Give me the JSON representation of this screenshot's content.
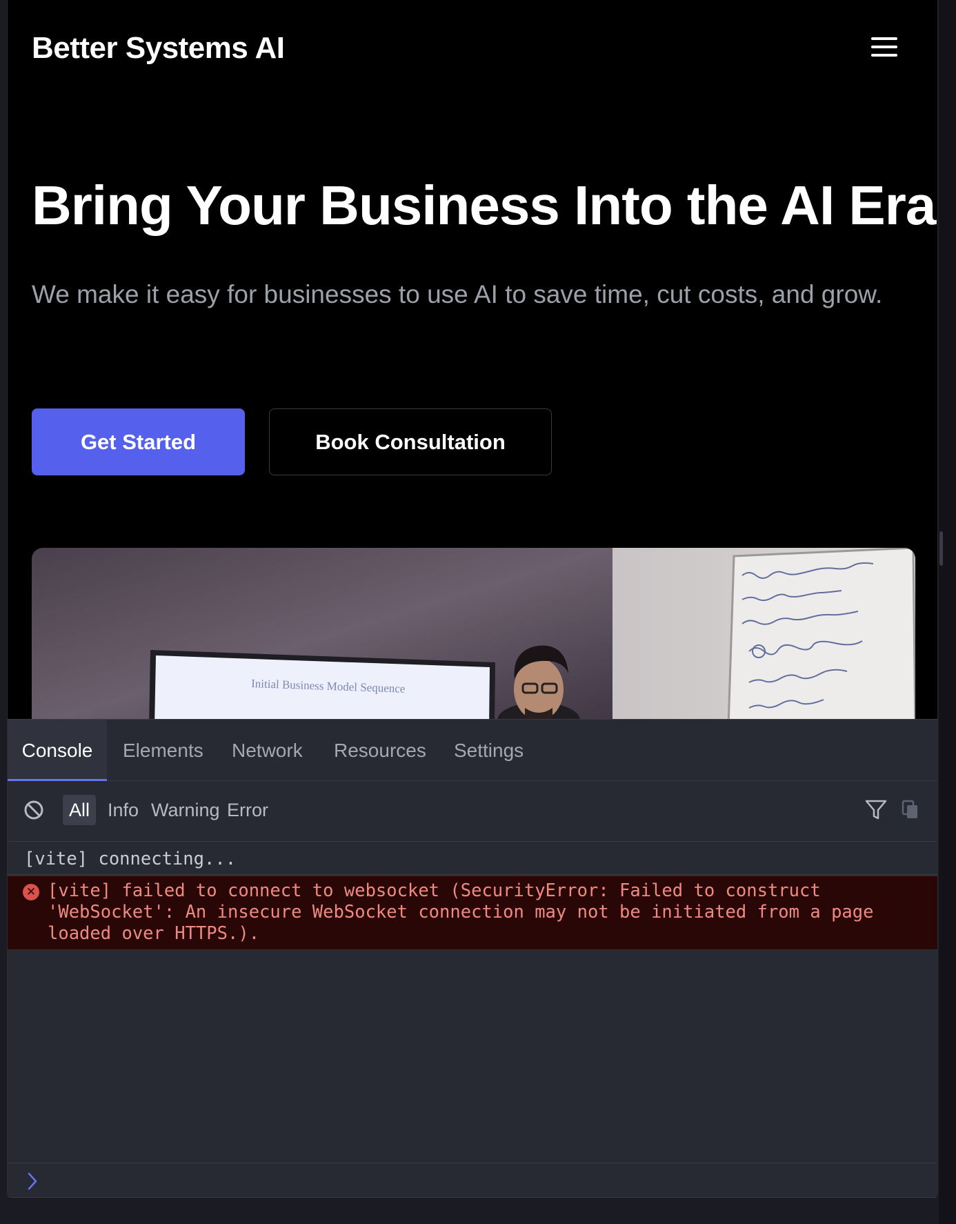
{
  "site": {
    "brand": "Better Systems AI",
    "menu_icon": "hamburger-menu-icon",
    "hero": {
      "title": "Bring Your Business Into the AI Era",
      "subtitle": "We make it easy for businesses to use AI to save time, cut costs, and grow.",
      "primary_button": "Get Started",
      "secondary_button": "Book Consultation",
      "image": {
        "screen_text": "Initial Business Model Sequence"
      }
    },
    "colors": {
      "background": "#000000",
      "accent": "#5561ec"
    }
  },
  "devtools": {
    "tabs": [
      {
        "label": "Console",
        "active": true
      },
      {
        "label": "Elements",
        "active": false
      },
      {
        "label": "Network",
        "active": false
      },
      {
        "label": "Resources",
        "active": false
      },
      {
        "label": "Settings",
        "active": false
      }
    ],
    "filters": [
      {
        "label": "All",
        "active": true
      },
      {
        "label": "Info",
        "active": false
      },
      {
        "label": "Warning",
        "active": false
      },
      {
        "label": "Error",
        "active": false
      }
    ],
    "icons": {
      "clear": "clear-console-icon",
      "filter": "filter-icon",
      "copy": "copy-icon",
      "error": "error-icon",
      "prompt": "prompt-chevron-icon"
    },
    "logs": [
      {
        "level": "info",
        "text": "[vite] connecting..."
      },
      {
        "level": "error",
        "text": "[vite] failed to connect to websocket (SecurityError: Failed to construct\n'WebSocket': An insecure WebSocket connection may not be initiated from a page\nloaded over HTTPS.)."
      }
    ],
    "colors": {
      "panel": "#272933",
      "error_bg": "#290707",
      "error_text": "#f08a80",
      "active_tab_underline": "#6774f0"
    }
  }
}
